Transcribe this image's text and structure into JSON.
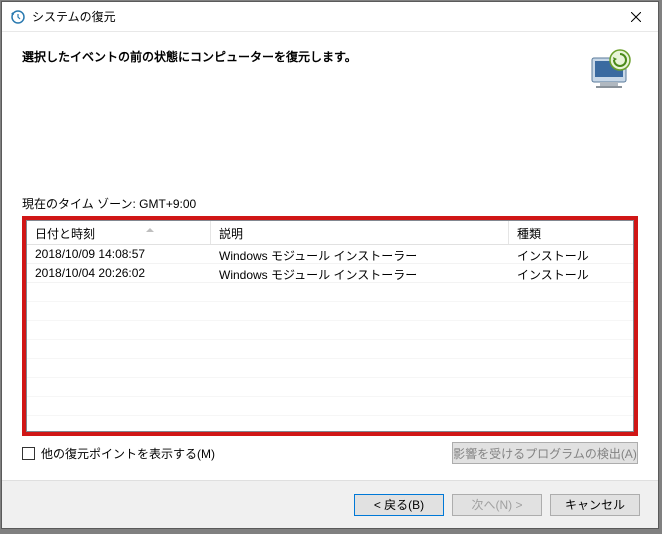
{
  "window": {
    "title": "システムの復元"
  },
  "content": {
    "instruction": "選択したイベントの前の状態にコンピューターを復元します。",
    "timezone": "現在のタイム ゾーン: GMT+9:00"
  },
  "table": {
    "headers": {
      "datetime": "日付と時刻",
      "description": "説明",
      "type": "種類"
    },
    "rows": [
      {
        "datetime": "2018/10/09 14:08:57",
        "description": "Windows モジュール インストーラー",
        "type": "インストール"
      },
      {
        "datetime": "2018/10/04 20:26:02",
        "description": "Windows モジュール インストーラー",
        "type": "インストール"
      }
    ]
  },
  "options": {
    "show_more_label": "他の復元ポイントを表示する(M)",
    "scan_button": "影響を受けるプログラムの検出(A)"
  },
  "footer": {
    "back": "< 戻る(B)",
    "next": "次へ(N) >",
    "cancel": "キャンセル"
  }
}
